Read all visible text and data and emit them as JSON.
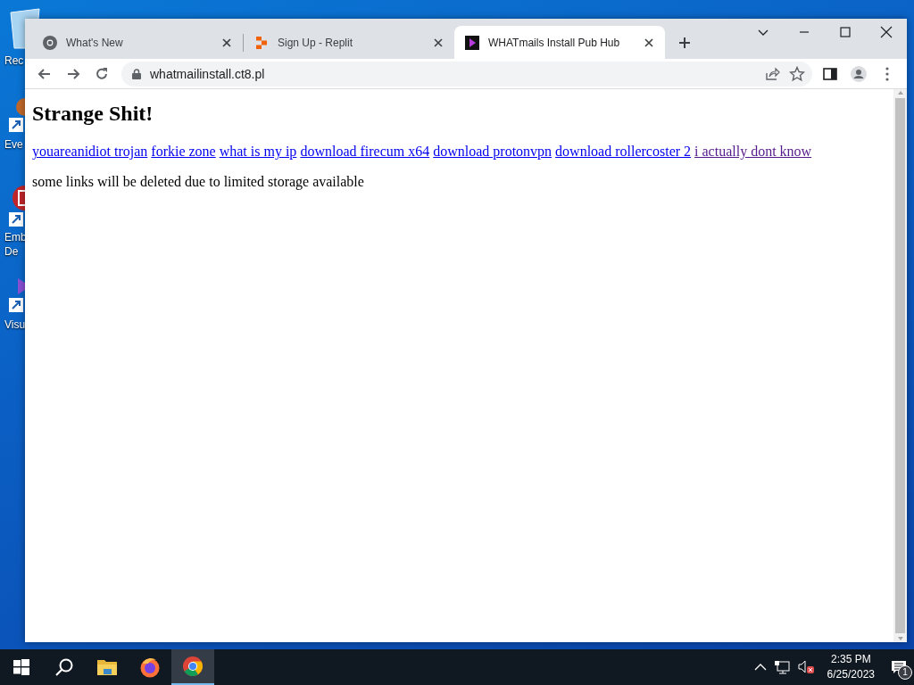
{
  "desktop_icons": [
    {
      "kind": "recycle",
      "label_lines": [
        "Rec"
      ]
    },
    {
      "kind": "event",
      "label_lines": [
        "Eve"
      ]
    },
    {
      "kind": "emb",
      "label_lines": [
        "Emb",
        "De"
      ]
    },
    {
      "kind": "visual",
      "label_lines": [
        "Visu"
      ]
    }
  ],
  "browser": {
    "tabs": [
      {
        "title": "What's New",
        "kind": "chrome",
        "selected": false
      },
      {
        "title": "Sign Up - Replit",
        "kind": "replit",
        "selected": false
      },
      {
        "title": "WHATmails Install Pub Hub",
        "kind": "purple",
        "selected": true
      }
    ],
    "address": "whatmailinstall.ct8.pl",
    "page": {
      "heading": "Strange Shit!",
      "links": [
        {
          "text": "youareanidiot trojan",
          "visited": false
        },
        {
          "text": "forkie zone",
          "visited": false
        },
        {
          "text": "what is my ip",
          "visited": false
        },
        {
          "text": "download firecum x64",
          "visited": false
        },
        {
          "text": "download protonvpn",
          "visited": false
        },
        {
          "text": "download rollercoster 2",
          "visited": false
        },
        {
          "text": "i actually dont know",
          "visited": true
        }
      ],
      "note": "some links will be deleted due to limited storage available"
    }
  },
  "taskbar": {
    "apps": [
      {
        "kind": "start",
        "active": false
      },
      {
        "kind": "search",
        "active": false
      },
      {
        "kind": "explorer",
        "active": false
      },
      {
        "kind": "firefox",
        "active": false
      },
      {
        "kind": "chrome",
        "active": true
      }
    ],
    "time": "2:35 PM",
    "date": "6/25/2023",
    "notifications": "1"
  }
}
